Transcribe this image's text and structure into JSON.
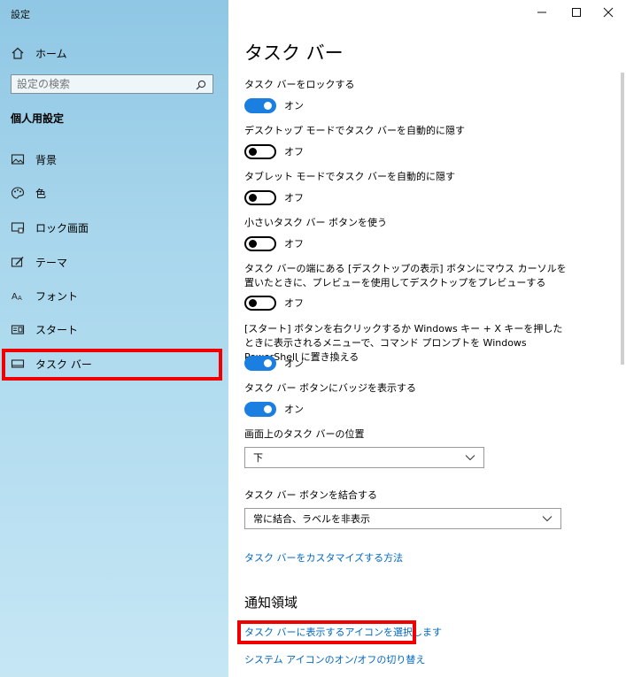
{
  "window": {
    "title": "設定",
    "controls": {
      "minimize": "minimize-icon",
      "maximize": "maximize-icon",
      "close": "close-icon"
    }
  },
  "sidebar": {
    "home_label": "ホーム",
    "search_placeholder": "設定の検索",
    "section_heading": "個人用設定",
    "items": [
      {
        "label": "背景",
        "icon": "picture-icon"
      },
      {
        "label": "色",
        "icon": "palette-icon"
      },
      {
        "label": "ロック画面",
        "icon": "lock-screen-icon"
      },
      {
        "label": "テーマ",
        "icon": "theme-icon"
      },
      {
        "label": "フォント",
        "icon": "font-icon"
      },
      {
        "label": "スタート",
        "icon": "start-icon"
      },
      {
        "label": "タスク バー",
        "icon": "taskbar-icon",
        "selected": true
      }
    ]
  },
  "main": {
    "title": "タスク バー",
    "settings": [
      {
        "label": "タスク バーをロックする",
        "state": "オン",
        "on": true
      },
      {
        "label": "デスクトップ モードでタスク バーを自動的に隠す",
        "state": "オフ",
        "on": false
      },
      {
        "label": "タブレット モードでタスク バーを自動的に隠す",
        "state": "オフ",
        "on": false
      },
      {
        "label": "小さいタスク バー ボタンを使う",
        "state": "オフ",
        "on": false
      },
      {
        "label": "タスク バーの端にある [デスクトップの表示] ボタンにマウス カーソルを置いたときに、プレビューを使用してデスクトップをプレビューする",
        "state": "オフ",
        "on": false
      },
      {
        "label": "[スタート] ボタンを右クリックするか Windows キー + X キーを押したときに表示されるメニューで、コマンド プロンプトを Windows PowerShell に置き換える",
        "state": "オン",
        "on": true
      },
      {
        "label": "タスク バー ボタンにバッジを表示する",
        "state": "オン",
        "on": true
      }
    ],
    "position": {
      "label": "画面上のタスク バーの位置",
      "value": "下"
    },
    "combine": {
      "label": "タスク バー ボタンを結合する",
      "value": "常に結合、ラベルを非表示"
    },
    "customize_link": "タスク バーをカスタマイズする方法",
    "notification_heading": "通知領域",
    "notification_links": [
      "タスク バーに表示するアイコンを選択します",
      "システム アイコンのオン/オフの切り替え"
    ]
  }
}
